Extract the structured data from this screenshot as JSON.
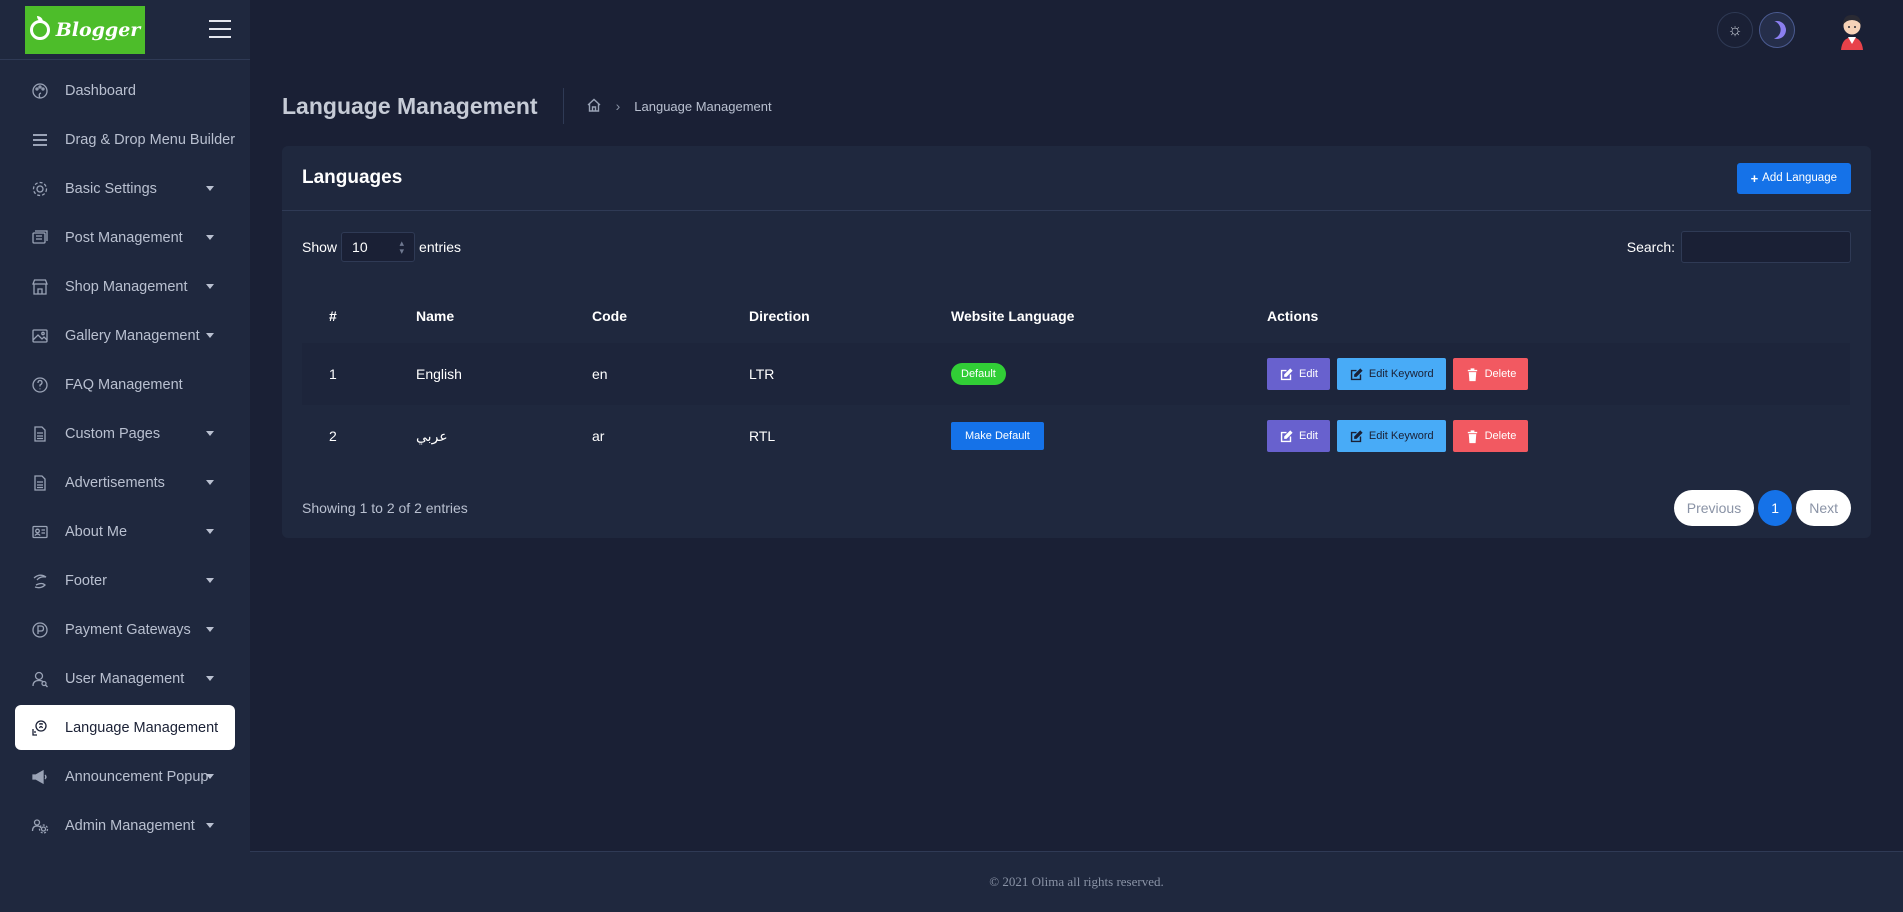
{
  "app": {
    "logo_text": "Blogger"
  },
  "sidebar": {
    "items": [
      {
        "label": "Dashboard",
        "icon": "palette-icon",
        "caret": false
      },
      {
        "label": "Drag & Drop Menu Builder",
        "icon": "bars-icon",
        "caret": false
      },
      {
        "label": "Basic Settings",
        "icon": "gear-icon",
        "caret": true
      },
      {
        "label": "Post Management",
        "icon": "posts-icon",
        "caret": true
      },
      {
        "label": "Shop Management",
        "icon": "shop-icon",
        "caret": true
      },
      {
        "label": "Gallery Management",
        "icon": "image-icon",
        "caret": true
      },
      {
        "label": "FAQ Management",
        "icon": "question-icon",
        "caret": false
      },
      {
        "label": "Custom Pages",
        "icon": "document-icon",
        "caret": true
      },
      {
        "label": "Advertisements",
        "icon": "document-icon",
        "caret": true
      },
      {
        "label": "About Me",
        "icon": "id-card-icon",
        "caret": true
      },
      {
        "label": "Footer",
        "icon": "footer-icon",
        "caret": true
      },
      {
        "label": "Payment Gateways",
        "icon": "payment-icon",
        "caret": true
      },
      {
        "label": "User Management",
        "icon": "user-search-icon",
        "caret": true
      },
      {
        "label": "Language Management",
        "icon": "language-icon",
        "caret": false,
        "active": true
      },
      {
        "label": "Announcement Popup",
        "icon": "megaphone-icon",
        "caret": true
      },
      {
        "label": "Admin Management",
        "icon": "users-gear-icon",
        "caret": true
      }
    ]
  },
  "header": {
    "page_title": "Language Management",
    "breadcrumb_current": "Language Management"
  },
  "card": {
    "title": "Languages",
    "add_button": "Add Language",
    "show_label": "Show",
    "entries_label": "entries",
    "page_size": "10",
    "search_label": "Search:",
    "search_value": "",
    "columns": [
      "#",
      "Name",
      "Code",
      "Direction",
      "Website Language",
      "Actions"
    ],
    "rows": [
      {
        "num": "1",
        "name": "English",
        "code": "en",
        "direction": "LTR",
        "website_language": "Default",
        "is_default": true
      },
      {
        "num": "2",
        "name": "عربي",
        "code": "ar",
        "direction": "RTL",
        "website_language": "Make Default",
        "is_default": false
      }
    ],
    "actions": {
      "edit": "Edit",
      "edit_keyword": "Edit Keyword",
      "delete": "Delete"
    },
    "info": "Showing 1 to 2 of 2 entries",
    "pagination": {
      "previous": "Previous",
      "current": "1",
      "next": "Next"
    }
  },
  "footer": {
    "text": "© 2021 Olima all rights reserved."
  },
  "colors": {
    "bg": "#1a2035",
    "panel": "#1f283e",
    "primary": "#1572e8",
    "success": "#31ce36",
    "edit": "#6861ce",
    "keyword": "#48abf7",
    "danger": "#f25961",
    "logo": "#4dbd2a"
  }
}
